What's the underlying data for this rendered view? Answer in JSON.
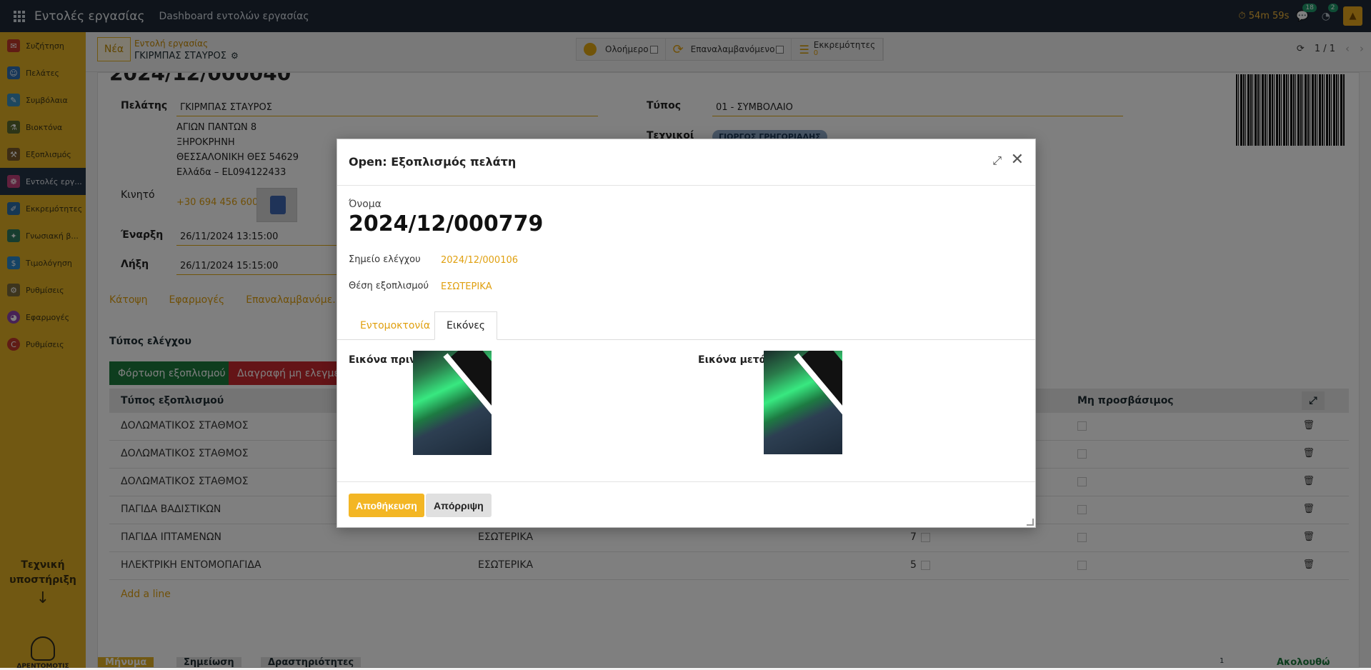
{
  "topbar": {
    "app_title": "Εντολές εργασίας",
    "menu_dashboard": "Dashboard εντολών εργασίας",
    "timer": "54m 59s",
    "messages_count": "18",
    "activities_count": "2"
  },
  "sidebar": {
    "items": [
      {
        "label": "Συζήτηση",
        "color": "#c0392b",
        "icon": "chat-icon"
      },
      {
        "label": "Πελάτες",
        "color": "#2f6fb3",
        "icon": "users-icon"
      },
      {
        "label": "Συμβόλαια",
        "color": "#3a8fbf",
        "icon": "contract-icon"
      },
      {
        "label": "Βιοκτόνα",
        "color": "#5b6b2e",
        "icon": "biocide-icon"
      },
      {
        "label": "Εξοπλισμός",
        "color": "#7a5a2a",
        "icon": "equipment-icon"
      },
      {
        "label": "Εντολές εργ...",
        "color": "#c2417a",
        "icon": "work-order-icon"
      },
      {
        "label": "Εκκρεμότητες",
        "color": "#2d6ea8",
        "icon": "pending-icon"
      },
      {
        "label": "Γνωσιακή β...",
        "color": "#2f7a5e",
        "icon": "knowledge-icon"
      },
      {
        "label": "Τιμολόγηση",
        "color": "#2a86c8",
        "icon": "invoice-icon"
      },
      {
        "label": "Ρυθμίσεις",
        "color": "#7b6a3a",
        "icon": "settings-icon"
      },
      {
        "label": "Εφαρμογές",
        "color": "#8e44ad",
        "icon": "apps-icon"
      },
      {
        "label": "Ρυθμίσεις",
        "color": "#c0392b",
        "icon": "settings-alt-icon"
      }
    ],
    "support_title": "Τεχνική υποστήριξη",
    "logo_text": "ΔΡΕΝΤΟΜΟΤΙΣ"
  },
  "control_panel": {
    "new_button": "Νέα",
    "breadcrumb_parent": "Εντολή εργασίας",
    "breadcrumb_current": "ΓΚΙΡΜΠΑΣ ΣΤΑΥΡΟΣ",
    "pill_allday": "Ολοήμερο",
    "pill_recurring": "Επαναλαμβανόμενο",
    "pill_pending": "Εκκρεμότητες",
    "pill_pending_count": "0",
    "pager": "1 / 1"
  },
  "record": {
    "number": "2024/12/000040",
    "customer_label": "Πελάτης",
    "customer": "ΓΚΙΡΜΠΑΣ ΣΤΑΥΡΟΣ",
    "address_line1": "ΑΓΙΩΝ ΠΑΝΤΩΝ 8",
    "address_line2": "ΞΗΡΟΚΡΗΝΗ",
    "address_line3": "ΘΕΣΣΑΛΟΝΙΚΗ ΘΕΣ 54629",
    "address_line4": "Ελλάδα – EL094122433",
    "mobile_label": "Κινητό",
    "mobile": "+30 694 456 6007",
    "start_label": "Έναρξη",
    "start": "26/11/2024 13:15:00",
    "end_label": "Λήξη",
    "end": "26/11/2024 15:15:00",
    "type_label": "Τύπος",
    "type": "01 - ΣΥΜΒΟΛΑΙΟ",
    "technicians_label": "Τεχνικοί",
    "technician": "ΓΙΩΡΓΟΣ ΓΡΗΓΟΡΙΑΔΗΣ"
  },
  "tabs": [
    "Κάτοψη",
    "Εφαρμογές",
    "Επαναλαμβανόμε..."
  ],
  "control_section": {
    "title": "Τύπος ελέγχου",
    "load_button": "Φόρτωση εξοπλισμού",
    "delete_button": "Διαγραφή μη ελεγμένων",
    "col_type": "Τύπος εξοπλισμού",
    "col_inaccessible": "Μη προσβάσιμος",
    "rows": [
      {
        "type": "ΔΟΛΩΜΑΤΙΚΟΣ ΣΤΑΘΜΟΣ",
        "location": "",
        "qty": ""
      },
      {
        "type": "ΔΟΛΩΜΑΤΙΚΟΣ ΣΤΑΘΜΟΣ",
        "location": "",
        "qty": ""
      },
      {
        "type": "ΔΟΛΩΜΑΤΙΚΟΣ ΣΤΑΘΜΟΣ",
        "location": "",
        "qty": ""
      },
      {
        "type": "ΠΑΓΙΔΑ ΒΑΔΙΣΤΙΚΩΝ",
        "location": "",
        "qty": ""
      },
      {
        "type": "ΠΑΓΙΔΑ ΙΠΤΑΜΕΝΩΝ",
        "location": "ΕΣΩΤΕΡΙΚΑ",
        "qty": "7"
      },
      {
        "type": "ΗΛΕΚΤΡΙΚΗ ΕΝΤΟΜΟΠΑΓΙΔΑ",
        "location": "ΕΣΩΤΕΡΙΚΑ",
        "qty": "5"
      }
    ],
    "add_line": "Add a line"
  },
  "bottom_bar": {
    "message": "Μήνυμα",
    "note": "Σημείωση",
    "activities": "Δραστηριότητες",
    "follow": "Ακολουθώ",
    "followers": "1"
  },
  "dialog": {
    "title": "Open: Εξοπλισμός πελάτη",
    "name_label": "Όνομα",
    "name": "2024/12/000779",
    "checkpoint_label": "Σημείο ελέγχου",
    "checkpoint": "2024/12/000106",
    "position_label": "Θέση εξοπλισμού",
    "position": "ΕΣΩΤΕΡΙΚΑ",
    "tab_insects": "Εντομοκτονία",
    "tab_images": "Εικόνες",
    "image_before_label": "Εικόνα πριν",
    "image_after_label": "Εικόνα μετά",
    "save_button": "Αποθήκευση",
    "discard_button": "Απόρριψη"
  }
}
